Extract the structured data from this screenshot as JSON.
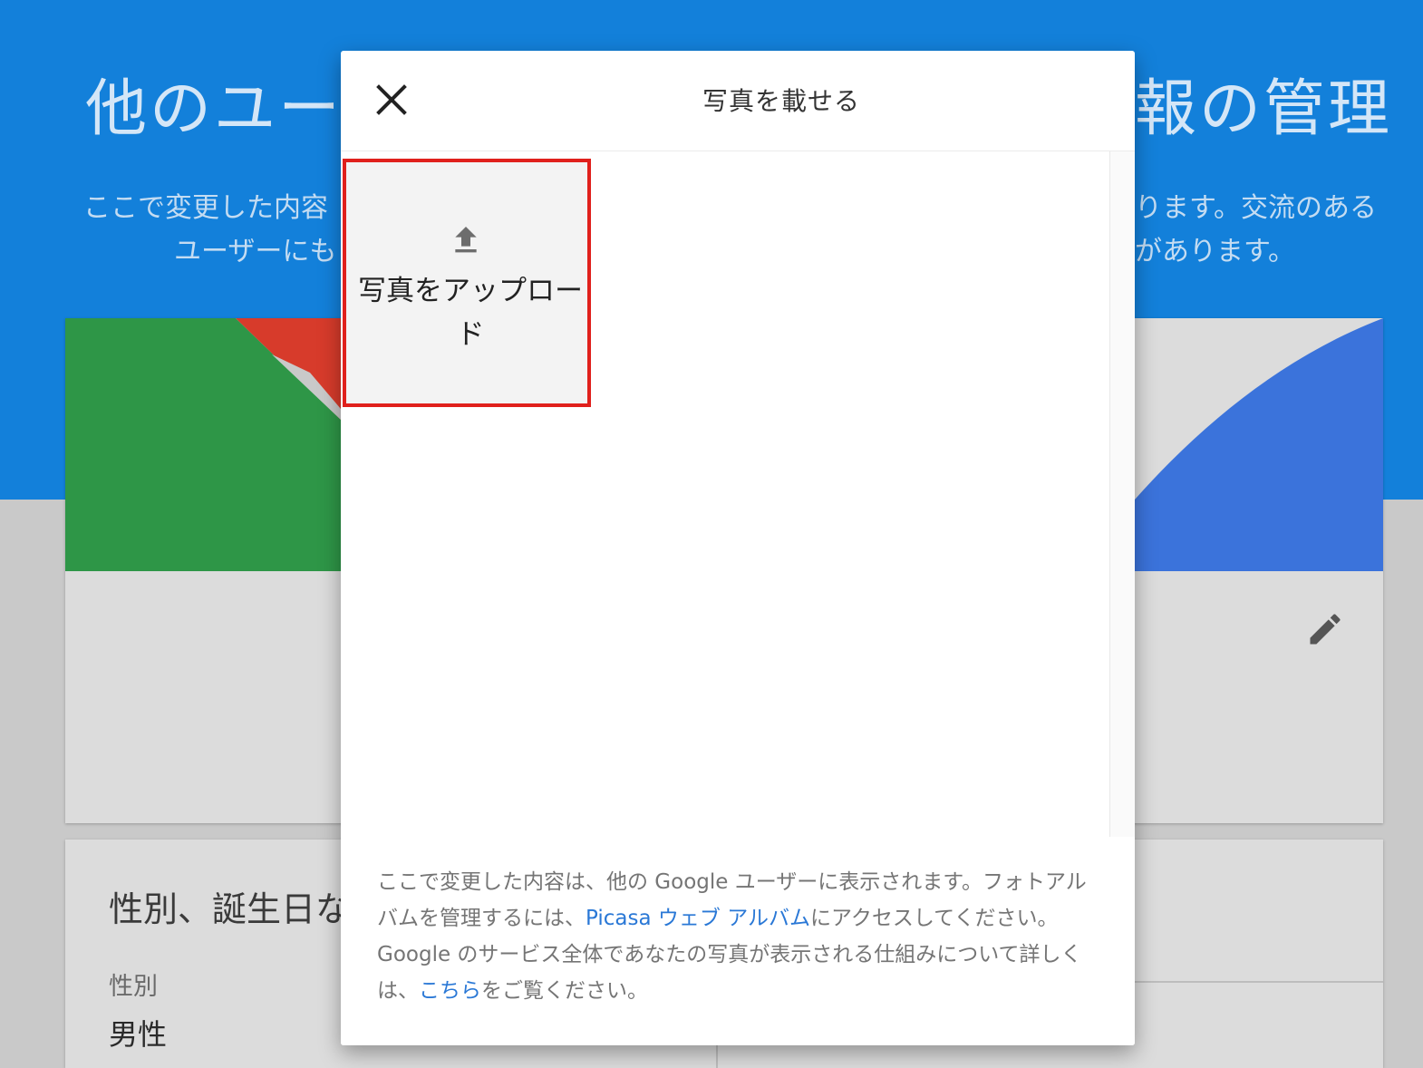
{
  "background": {
    "title_left": "他のユーザ",
    "title_right": "報の管理",
    "desc_line1_left": "ここで変更した内容",
    "desc_line2_left": "ユーザーにも",
    "desc_line1_right": "ります。交流のある",
    "desc_line2_right": "があります。",
    "section_title": "性別、誕生日な",
    "gender_label": "性別",
    "gender_value": "男性",
    "colors": {
      "header_blue": "#1380da",
      "banner_green": "#2e9647",
      "banner_red": "#d73b2b",
      "banner_blue": "#3b73db"
    }
  },
  "dialog": {
    "title": "写真を載せる",
    "close_icon": "close-icon",
    "upload_tile": {
      "icon": "upload-icon",
      "label": "写真をアップロード"
    },
    "footer": {
      "text_part1": "ここで変更した内容は、他の Google ユーザーに表示されます。フォトアルバムを管理するには、",
      "link1": "Picasa ウェブ アルバム",
      "text_part2": "にアクセスしてください。Google のサービス全体であなたの写真が表示される仕組みについて詳しくは、",
      "link2": "こちら",
      "text_part3": "をご覧ください。"
    },
    "highlight_color": "#e0201c",
    "link_color": "#2a78d6"
  }
}
